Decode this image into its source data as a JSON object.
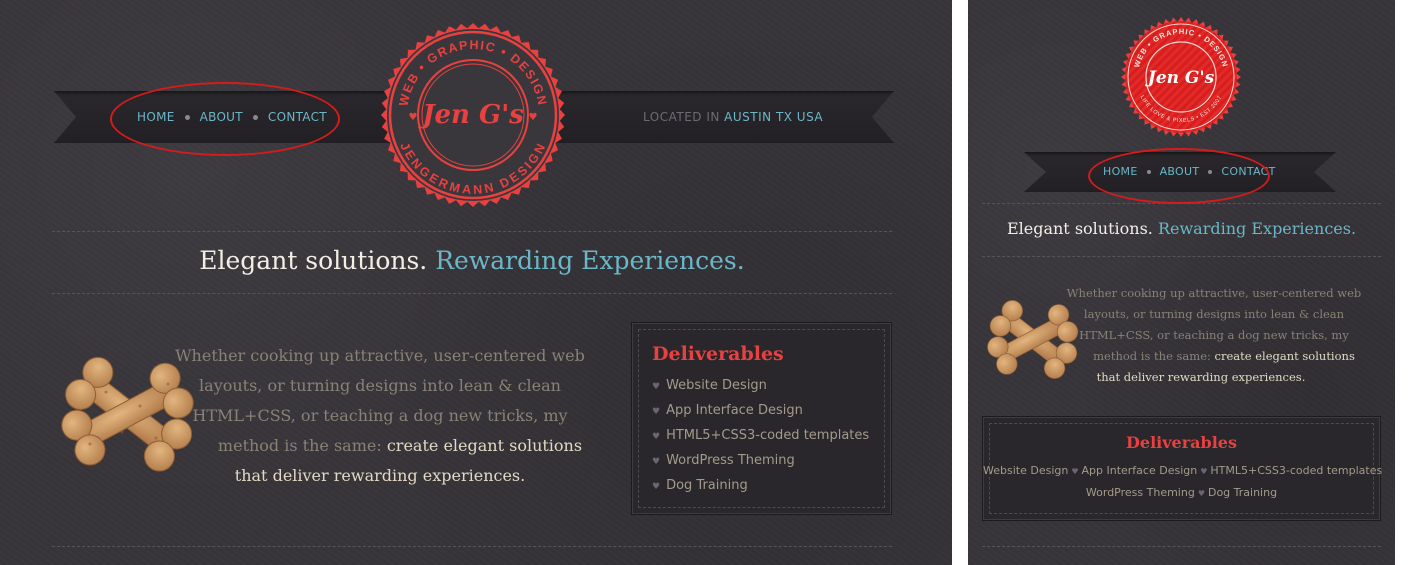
{
  "desktop": {
    "nav": [
      "HOME",
      "ABOUT",
      "CONTACT"
    ],
    "location_prefix": "LOCATED IN",
    "location_city": "AUSTIN TX USA",
    "logo": {
      "arc_top": "WEB • GRAPHIC • DESIGN",
      "arc_bottom": "JENGERMANN DESIGN",
      "name": "Jen G's"
    },
    "tagline_plain": "Elegant solutions.",
    "tagline_accent": "Rewarding Experiences.",
    "intro_lines": [
      "Whether cooking up attractive, user-centered web",
      "layouts, or turning designs into lean & clean",
      "HTML+CSS, or teaching a dog new tricks, my"
    ],
    "intro_line4_plain": "method is the same:",
    "intro_line4_strong": "create elegant solutions",
    "intro_line5_strong": "that deliver rewarding experiences.",
    "deliverables_title": "Deliverables",
    "deliverables": [
      "Website Design",
      "App Interface Design",
      "HTML5+CSS3-coded templates",
      "WordPress Theming",
      "Dog Training"
    ]
  },
  "mobile": {
    "logo": {
      "arc_top": "WEB • GRAPHIC • DESIGN",
      "arc_bottom": "LIFE LOVE & PIXELS • EST 2007",
      "name": "Jen G's"
    },
    "nav": [
      "HOME",
      "ABOUT",
      "CONTACT"
    ],
    "tagline_plain": "Elegant solutions.",
    "tagline_accent": "Rewarding Experiences.",
    "intro_lines": [
      "Whether cooking up attractive, user-centered web",
      "layouts, or turning designs into lean & clean",
      "HTML+CSS, or teaching a dog new tricks, my"
    ],
    "intro_line4_plain": "method is the same:",
    "intro_line4_strong": "create elegant solutions",
    "intro_line5_strong": "that deliver rewarding experiences.",
    "deliverables_title": "Deliverables",
    "deliverables_row1": [
      "Website Design",
      "App Interface Design",
      "HTML5+CSS3-coded templates"
    ],
    "deliverables_row2": [
      "WordPress Theming",
      "Dog Training"
    ]
  },
  "colors": {
    "accent_teal": "#6bb7c7",
    "logo_red": "#e8413f",
    "annotation_red": "#d41c1c",
    "background": "#38353a"
  }
}
